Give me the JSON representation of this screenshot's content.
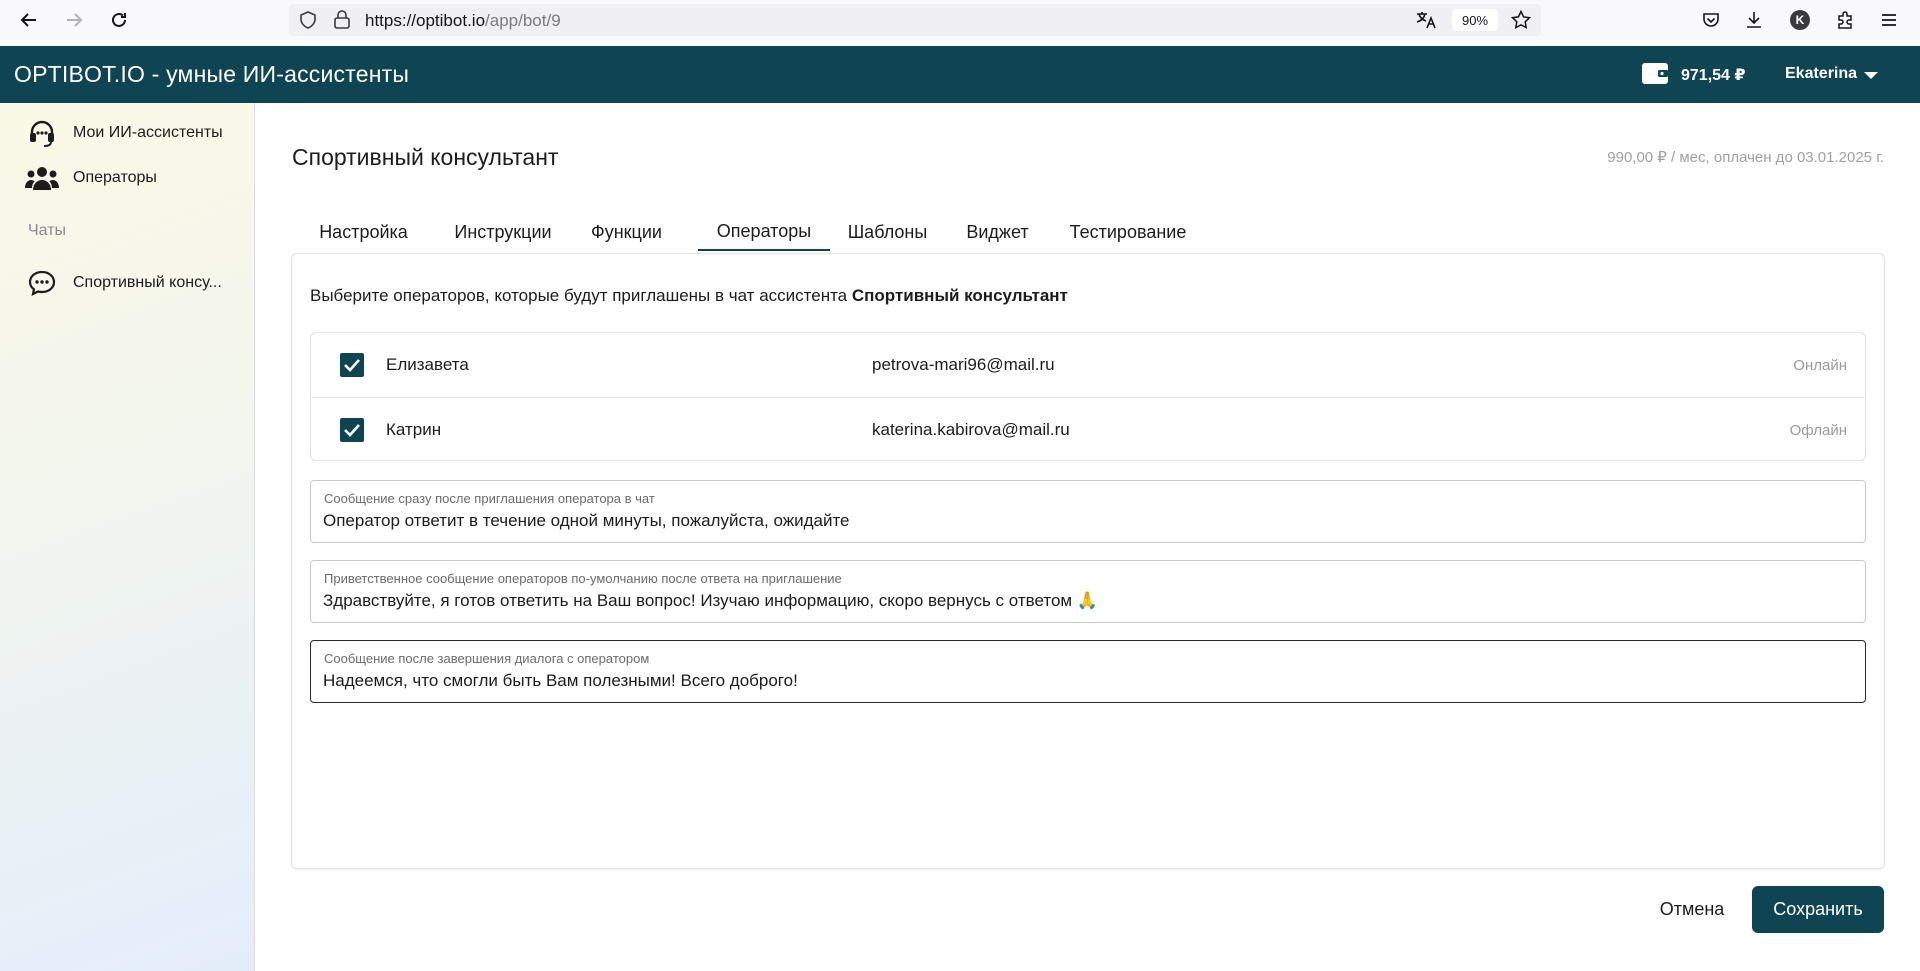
{
  "browser": {
    "url_host": "https://optibot.io",
    "url_path": "/app/bot/9",
    "zoom": "90%",
    "profile_initial": "K"
  },
  "header": {
    "app_title": "OPTIBOT.IO - умные ИИ-ассистенты",
    "balance": "971,54 ₽",
    "user_name": "Ekaterina"
  },
  "sidebar": {
    "items": [
      {
        "label": "Мои ИИ-ассистенты",
        "icon": "headset-icon"
      },
      {
        "label": "Операторы",
        "icon": "users-icon"
      }
    ],
    "section_label": "Чаты",
    "chats": [
      {
        "label": "Спортивный консу...",
        "icon": "chat-bubble-icon"
      }
    ]
  },
  "page": {
    "title": "Спортивный консультант",
    "plan_info": "990,00 ₽ / мес, оплачен до 03.01.2025 г."
  },
  "tabs": [
    {
      "label": "Настройка"
    },
    {
      "label": "Инструкции"
    },
    {
      "label": "Функции"
    },
    {
      "label": "Операторы",
      "active": true
    },
    {
      "label": "Шаблоны"
    },
    {
      "label": "Виджет"
    },
    {
      "label": "Тестирование"
    }
  ],
  "operators": {
    "intro_prefix": "Выберите операторов, которые будут приглашены в чат ассистента ",
    "intro_bot_name": "Спортивный консультант",
    "list": [
      {
        "name": "Елизавета",
        "email": "petrova-mari96@mail.ru",
        "status": "Онлайн",
        "checked": true
      },
      {
        "name": "Катрин",
        "email": "katerina.kabirova@mail.ru",
        "status": "Офлайн",
        "checked": true
      }
    ]
  },
  "fields": {
    "invite_message": {
      "label": "Сообщение сразу после приглашения оператора в чат",
      "value": "Оператор ответит в течение одной минуты, пожалуйста, ожидайте"
    },
    "greeting_message": {
      "label": "Приветственное сообщение операторов по-умолчанию после ответа на приглашение",
      "value": "Здравствуйте, я готов ответить на Ваш вопрос! Изучаю информацию, скоро вернусь с ответом 🙏"
    },
    "finish_message": {
      "label": "Сообщение после завершения диалога с оператором",
      "value": "Надеемся, что смогли быть Вам полезными! Всего доброго!"
    }
  },
  "actions": {
    "cancel_label": "Отмена",
    "save_label": "Сохранить"
  },
  "colors": {
    "brand": "#0f4552",
    "muted_text": "#9a9a9a"
  }
}
